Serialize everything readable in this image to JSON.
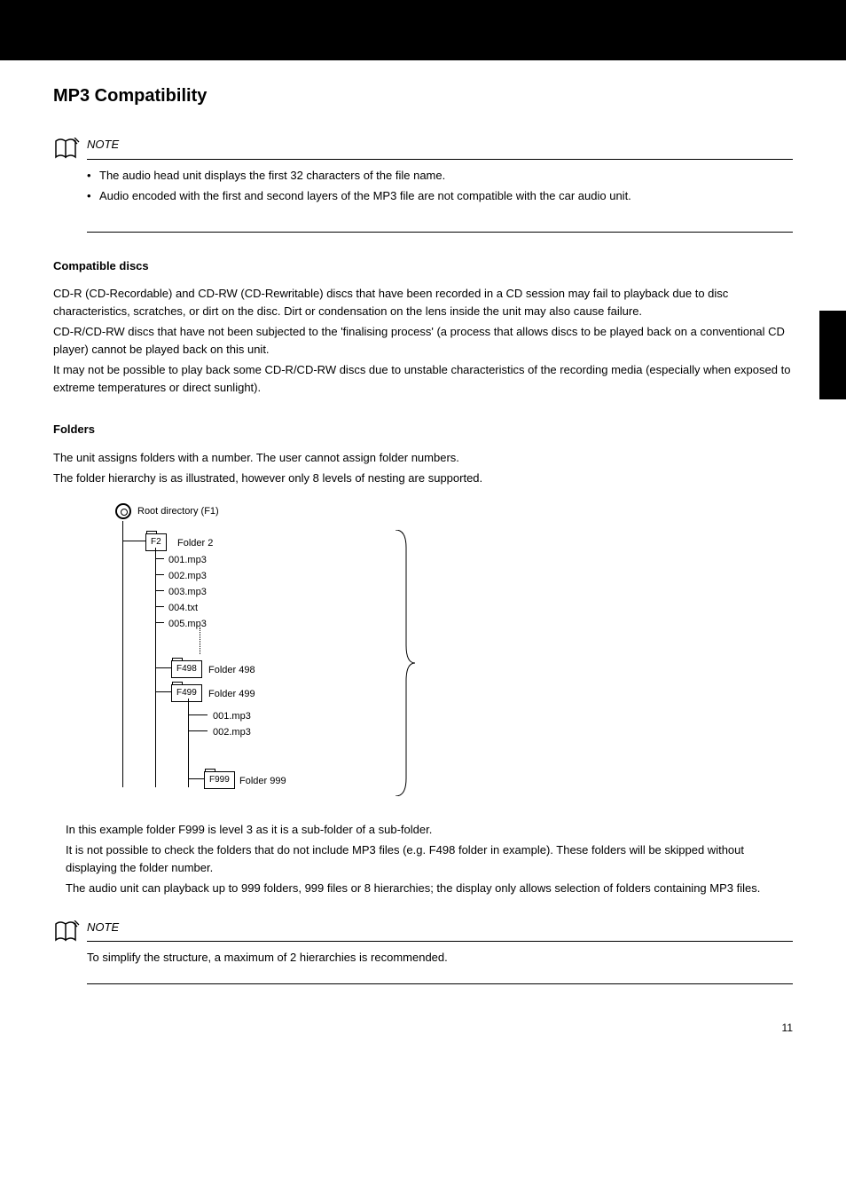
{
  "header": {
    "subtitle": "MP3 Compatibility"
  },
  "note1": {
    "label": "NOTE",
    "bullets": [
      "The audio head unit displays the first 32 characters of the file name.",
      "Audio encoded with the first and second layers of the MP3 file are not compatible with the car audio unit."
    ]
  },
  "discs": {
    "heading": "Compatible discs",
    "para1": "CD-R (CD-Recordable) and CD-RW (CD-Rewritable) discs that have been recorded in a CD session may fail to playback due to disc characteristics, scratches, or dirt on the disc. Dirt or condensation on the lens inside the unit may also cause failure.",
    "para2": "CD-R/CD-RW discs that have not been subjected to the 'finalising process' (a process that allows discs to be played back on a conventional CD player) cannot be played back on this unit.",
    "para3": "It may not be possible to play back some CD-R/CD-RW discs due to unstable characteristics of the recording media (especially when exposed to extreme temperatures or direct sunlight)."
  },
  "folders": {
    "heading": "Folders",
    "para1": "The unit assigns folders with a number. The user cannot assign folder numbers.",
    "para2": "The folder hierarchy is as illustrated, however only 8 levels of nesting are supported.",
    "tree": {
      "root": "Root directory (F1)",
      "f2": "F2",
      "f2label": "Folder 2",
      "files": [
        "001.mp3",
        "002.mp3",
        "003.mp3",
        "004.txt",
        "005.mp3"
      ],
      "f498": "F498",
      "f498label": "Folder 498",
      "f499": "F499",
      "f499label": "Folder 499",
      "f499files": [
        "001.mp3",
        "002.mp3"
      ],
      "f999": "F999",
      "f999label": "Folder 999"
    },
    "para3": "In this example folder F999 is level 3 as it is a sub-folder of a sub-folder.",
    "para4": "It is not possible to check the folders that do not include MP3 files (e.g. F498 folder in example). These folders will be skipped without displaying the folder number.",
    "para5": "The audio unit can playback up to 999 folders, 999 files or 8 hierarchies; the display only allows selection of folders containing MP3 files."
  },
  "note2": {
    "label": "NOTE",
    "text": "To simplify the structure, a maximum of 2 hierarchies is recommended."
  },
  "page": "11"
}
